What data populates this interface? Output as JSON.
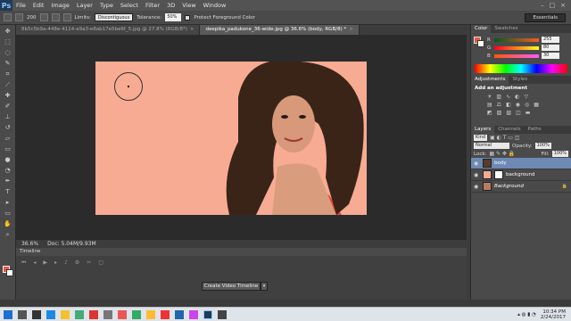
{
  "app": {
    "logo": "Ps"
  },
  "menu": [
    "File",
    "Edit",
    "Image",
    "Layer",
    "Type",
    "Select",
    "Filter",
    "3D",
    "View",
    "Window"
  ],
  "window_buttons": [
    "–",
    "□",
    "×"
  ],
  "options": {
    "brush_size": "200",
    "limits_label": "Limits:",
    "limits_value": "Discontiguous",
    "tolerance_label": "Tolerance:",
    "tolerance_value": "50%",
    "protect_label": "Protect Foreground Color",
    "workspace": "Essentials"
  },
  "tabs": [
    {
      "label": "8b5c5b9a-448e-4114-a9a3-e8ab17e5be6f_5.jpg @ 27.8% (RGB/8*)",
      "close": "×"
    },
    {
      "label": "deepika_padukone_36-wide.jpg @ 36.6% (body, RGB/8) *",
      "close": "×"
    }
  ],
  "status": {
    "zoom": "36.6%",
    "doc": "Doc: 5.04M/9.93M"
  },
  "timeline": {
    "title": "Timeline",
    "create_label": "Create Video Timeline",
    "dropdown": "▾"
  },
  "color_panel": {
    "tabs": [
      "Color",
      "Swatches"
    ],
    "r": "255",
    "g": "80",
    "b": "30",
    "labels": [
      "R",
      "G",
      "B"
    ]
  },
  "adjustments": {
    "tabs": [
      "Adjustments",
      "Styles"
    ],
    "title": "Add an adjustment"
  },
  "layers_panel": {
    "tabs": [
      "Layers",
      "Channels",
      "Paths"
    ],
    "kind": "Kind",
    "blend": "Normal",
    "opacity_label": "Opacity:",
    "opacity": "100%",
    "lock_label": "Lock:",
    "fill_label": "Fill:",
    "fill": "100%",
    "layers": [
      {
        "name": "body",
        "selected": true
      },
      {
        "name": "background",
        "selected": false
      },
      {
        "name": "Background",
        "selected": false
      }
    ]
  },
  "taskbar": {
    "time": "10:34 PM",
    "date": "2/24/2017"
  },
  "colors": {
    "foreground": "#ea5a3c",
    "canvas": "#f7ab93",
    "hair": "#3a2418",
    "dress": "#e9433a"
  }
}
